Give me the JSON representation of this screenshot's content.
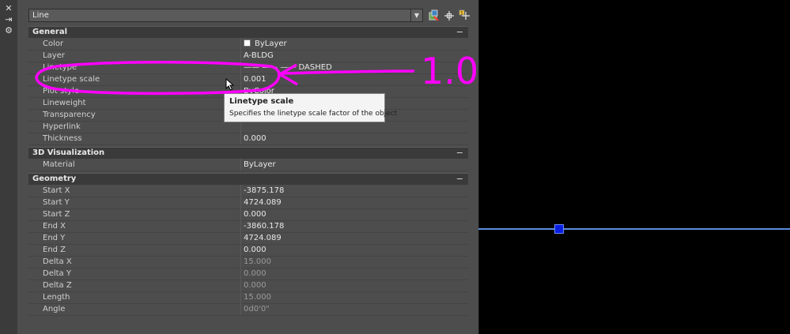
{
  "palette": {
    "object_type": "Line",
    "sections": [
      {
        "title": "General",
        "collapse": "−",
        "rows": [
          {
            "name": "Color",
            "value": "ByLayer",
            "swatch": true
          },
          {
            "name": "Layer",
            "value": "A-BLDG"
          },
          {
            "name": "Linetype",
            "value": "—— —— —— DASHED"
          },
          {
            "name": "Linetype scale",
            "value": "0.001"
          },
          {
            "name": "Plot style",
            "value": "ByColor"
          },
          {
            "name": "Lineweight",
            "value": ""
          },
          {
            "name": "Transparency",
            "value": ""
          },
          {
            "name": "Hyperlink",
            "value": ""
          },
          {
            "name": "Thickness",
            "value": "0.000"
          }
        ]
      },
      {
        "title": "3D Visualization",
        "collapse": "−",
        "rows": [
          {
            "name": "Material",
            "value": "ByLayer"
          }
        ]
      },
      {
        "title": "Geometry",
        "collapse": "−",
        "rows": [
          {
            "name": "Start X",
            "value": "-3875.178"
          },
          {
            "name": "Start Y",
            "value": "4724.089"
          },
          {
            "name": "Start Z",
            "value": "0.000"
          },
          {
            "name": "End X",
            "value": "-3860.178"
          },
          {
            "name": "End Y",
            "value": "4724.089"
          },
          {
            "name": "End Z",
            "value": "0.000"
          },
          {
            "name": "Delta X",
            "value": "15.000",
            "readonly": true
          },
          {
            "name": "Delta Y",
            "value": "0.000",
            "readonly": true
          },
          {
            "name": "Delta Z",
            "value": "0.000",
            "readonly": true
          },
          {
            "name": "Length",
            "value": "15.000",
            "readonly": true
          },
          {
            "name": "Angle",
            "value": "0d0'0\"",
            "readonly": true
          }
        ]
      }
    ]
  },
  "tooltip": {
    "title": "Linetype scale",
    "description": "Specifies the linetype scale factor of the object"
  },
  "annotation": {
    "text": "1.0",
    "color": "#ff00ff"
  },
  "strip": {
    "close": "✕",
    "pin": "⇥",
    "settings": "⚙"
  },
  "colors": {
    "canvas_line": "#5b8ddc",
    "grip": "#0a1ee0"
  },
  "icons": [
    "quick-select-icon",
    "select-objects-icon",
    "toggle-pickadd-icon",
    "close-icon",
    "autohide-icon",
    "properties-icon",
    "chevron-down-icon",
    "mouse-cursor-icon"
  ]
}
